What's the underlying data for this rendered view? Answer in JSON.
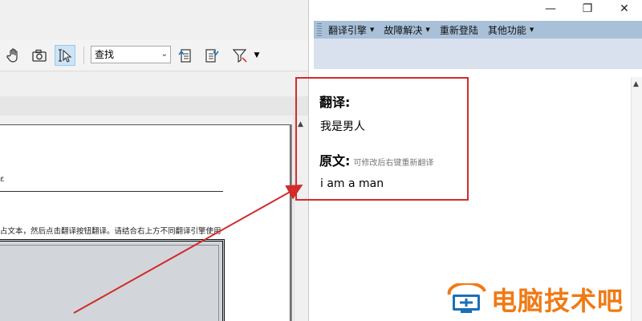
{
  "toolbar": {
    "search_value": "查找",
    "search_options": [
      "查找"
    ]
  },
  "translator": {
    "menu": [
      {
        "label": "翻译引擎",
        "has_dropdown": true
      },
      {
        "label": "故障解决",
        "has_dropdown": true
      },
      {
        "label": "重新登陆",
        "has_dropdown": false
      },
      {
        "label": "其他功能",
        "has_dropdown": true
      }
    ],
    "translation_label": "翻译:",
    "translation_text": "我是男人",
    "original_label": "原文:",
    "original_hint": "可修改后右键重新翻译",
    "original_text": "i am a man"
  },
  "document": {
    "instruction_text": "占文本，然后点击翻译按钮翻译。请结合右上方不同翻译引擎使用",
    "fragment_text": "ε"
  },
  "window_controls": {
    "minimize": "—",
    "restore": "❐",
    "close": "✕"
  },
  "watermark": {
    "text": "电脑技术吧"
  },
  "colors": {
    "highlight_box": "#d32a2a",
    "menu_bar": "#a8c0d8",
    "toolbar_band": "#d9e0ee",
    "watermark": "#f07a14"
  }
}
